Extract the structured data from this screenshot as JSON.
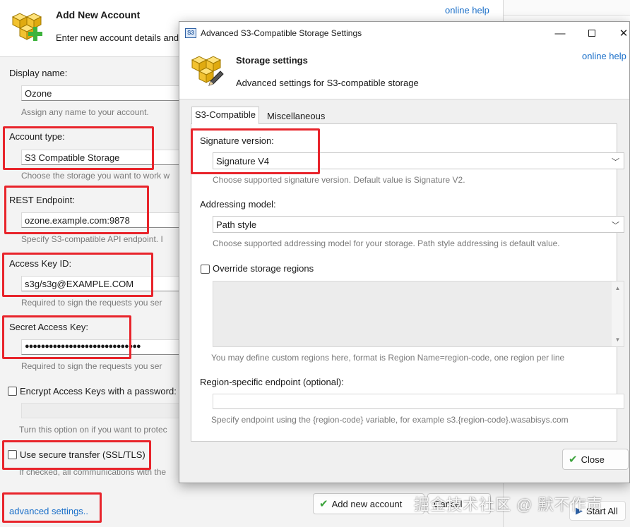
{
  "background_window": {
    "title": "Add New Account",
    "subtitle": "Enter new account details and",
    "help_link": "online help",
    "display_name": {
      "label": "Display name:",
      "value": "Ozone",
      "hint": "Assign any name to your account."
    },
    "account_type": {
      "label": "Account type:",
      "value": "S3 Compatible Storage",
      "hint": "Choose the storage you want to work w"
    },
    "rest_endpoint": {
      "label": "REST Endpoint:",
      "value": "ozone.example.com:9878",
      "hint": "Specify S3-compatible API endpoint. I"
    },
    "access_key": {
      "label": "Access Key ID:",
      "value": "s3g/s3g@EXAMPLE.COM",
      "hint": "Required to sign the requests you ser"
    },
    "secret_key": {
      "label": "Secret Access Key:",
      "value": "●●●●●●●●●●●●●●●●●●●●●●●●●●●●●",
      "hint": "Required to sign the requests you ser"
    },
    "encrypt": {
      "label": "Encrypt Access Keys with a password:",
      "hint": "Turn this option on if you want to protec"
    },
    "ssl": {
      "label": "Use secure transfer (SSL/TLS)",
      "hint": "If checked, all communications with the"
    },
    "advanced_link": "advanced settings..",
    "add_button": "Add new account",
    "cancel_button": "Cancel",
    "start_all": "Start All"
  },
  "modal": {
    "window_title": "Advanced S3-Compatible Storage Settings",
    "app_icon_text": "S3",
    "header_title": "Storage settings",
    "header_subtitle": "Advanced settings for S3-compatible storage",
    "help_link": "online help",
    "tabs": [
      {
        "label": "S3-Compatible",
        "active": true
      },
      {
        "label": "Miscellaneous",
        "active": false
      }
    ],
    "signature": {
      "label": "Signature version:",
      "value": "Signature V4",
      "hint": "Choose supported signature version. Default value is Signature V2."
    },
    "addressing": {
      "label": "Addressing model:",
      "value": "Path style",
      "hint": "Choose supported addressing model for your storage. Path style addressing is default value."
    },
    "override_regions": {
      "label": "Override storage regions",
      "hint": "You may define custom regions here, format is Region Name=region-code, one region per line"
    },
    "region_endpoint": {
      "label": "Region-specific endpoint (optional):",
      "value": "",
      "hint": "Specify endpoint using the {region-code} variable, for example s3.{region-code}.wasabisys.com"
    },
    "close_button": "Close"
  },
  "watermark": "掘金技术社区 @ 默不作声",
  "colors": {
    "highlight": "#e8242b",
    "link": "#1a6fc9",
    "accent_check": "#3aa23a"
  },
  "icons": [
    "storage-cubes-icon",
    "add-plus-icon",
    "edit-pencil-icon",
    "check-icon",
    "minimize-icon",
    "maximize-icon",
    "close-icon",
    "chevron-down-icon"
  ]
}
